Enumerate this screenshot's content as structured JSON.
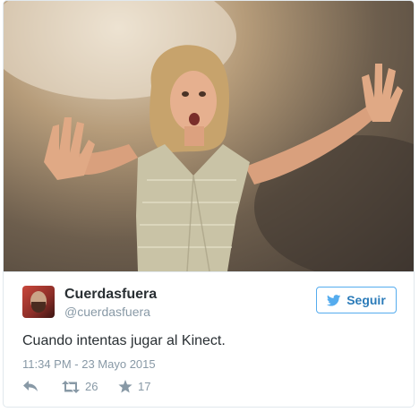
{
  "tweet": {
    "author": {
      "display_name": "Cuerdasfuera",
      "handle": "@cuerdasfuera"
    },
    "follow_label": "Seguir",
    "text": "Cuando intentas jugar al Kinect.",
    "timestamp": "11:34 PM - 23 Mayo 2015",
    "retweets": "26",
    "likes": "17"
  },
  "icons": {
    "follow": "twitter-bird-icon",
    "reply": "reply-icon",
    "retweet": "retweet-icon",
    "like": "star-icon"
  },
  "colors": {
    "accent": "#55acee",
    "text": "#292f33",
    "muted": "#8899a6",
    "border": "#e1e8ed"
  }
}
